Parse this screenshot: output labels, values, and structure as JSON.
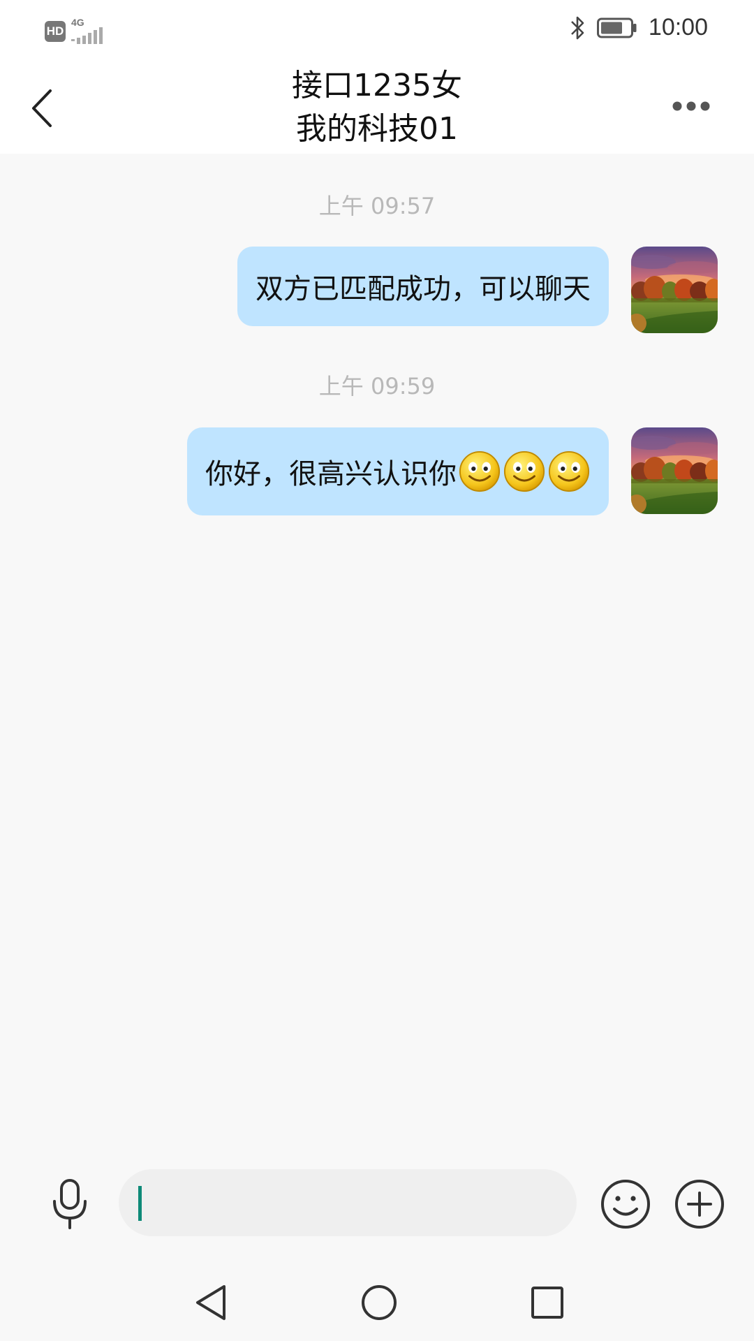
{
  "status_bar": {
    "hd_label": "HD",
    "network_label": "4G",
    "time": "10:00",
    "icons": [
      "hd-icon",
      "signal-icon",
      "bluetooth-icon",
      "battery-icon"
    ]
  },
  "header": {
    "title_line1": "接口1235女",
    "title_line2": "我的科技01",
    "icons": {
      "back": "back-arrow-icon",
      "more": "more-dots-icon"
    }
  },
  "messages": [
    {
      "timestamp": "上午 09:57",
      "text": "双方已匹配成功，可以聊天",
      "emoji_count": 0,
      "sender": "self"
    },
    {
      "timestamp": "上午 09:59",
      "text": "你好，很高兴认识你",
      "emoji_count": 3,
      "emoji": "smiley-emoji",
      "sender": "self"
    }
  ],
  "input_bar": {
    "value": "",
    "placeholder": "",
    "icons": {
      "voice": "microphone-icon",
      "emoji": "smiley-face-icon",
      "more": "plus-circle-icon"
    }
  },
  "nav_bar": {
    "icons": [
      "nav-back-triangle-icon",
      "nav-home-circle-icon",
      "nav-recents-square-icon"
    ]
  },
  "colors": {
    "bubble": "#bfe4ff",
    "background": "#f8f8f8",
    "header": "#ffffff",
    "timestamp": "#b8b8b8",
    "cursor": "#0e8a78"
  }
}
